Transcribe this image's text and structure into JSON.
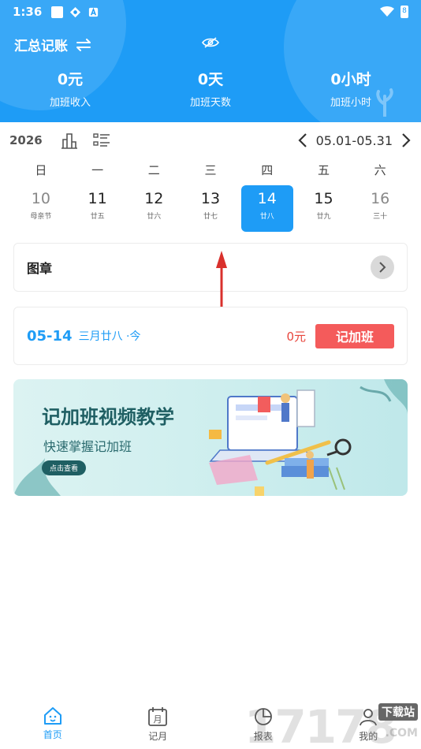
{
  "status_bar": {
    "time": "1:36",
    "battery": "8"
  },
  "header": {
    "title": "汇总记账",
    "stats": [
      {
        "value": "0元",
        "label": "加班收入"
      },
      {
        "value": "0天",
        "label": "加班天数"
      },
      {
        "value": "0小时",
        "label": "加班小时"
      }
    ]
  },
  "toolbar": {
    "year": "2026",
    "range": "05.01-05.31"
  },
  "calendar": {
    "weekdays": [
      "日",
      "一",
      "二",
      "三",
      "四",
      "五",
      "六"
    ],
    "days": [
      {
        "num": "10",
        "sub": "母亲节"
      },
      {
        "num": "11",
        "sub": "廿五"
      },
      {
        "num": "12",
        "sub": "廿六"
      },
      {
        "num": "13",
        "sub": "廿七"
      },
      {
        "num": "14",
        "sub": "廿八"
      },
      {
        "num": "15",
        "sub": "廿九"
      },
      {
        "num": "16",
        "sub": "三十"
      }
    ]
  },
  "stamp_card": {
    "label": "图章"
  },
  "overtime_card": {
    "date": "05-14",
    "lunar": "三月廿八 ·今",
    "amount": "0元",
    "button": "记加班"
  },
  "banner": {
    "title": "记加班视频教学",
    "subtitle": "快速掌握记加班",
    "button": "点击查看"
  },
  "bottom_nav": [
    {
      "label": "首页",
      "icon": "home-icon"
    },
    {
      "label": "记月",
      "icon": "calendar-icon"
    },
    {
      "label": "报表",
      "icon": "report-icon"
    },
    {
      "label": "我的",
      "icon": "profile-icon"
    }
  ],
  "watermark": {
    "number": "17178",
    "tag": "下载站",
    "domain": ".COM"
  },
  "colors": {
    "accent": "#1e9cf6",
    "button_red": "#f45b5b",
    "amount_red": "#e8453c"
  }
}
